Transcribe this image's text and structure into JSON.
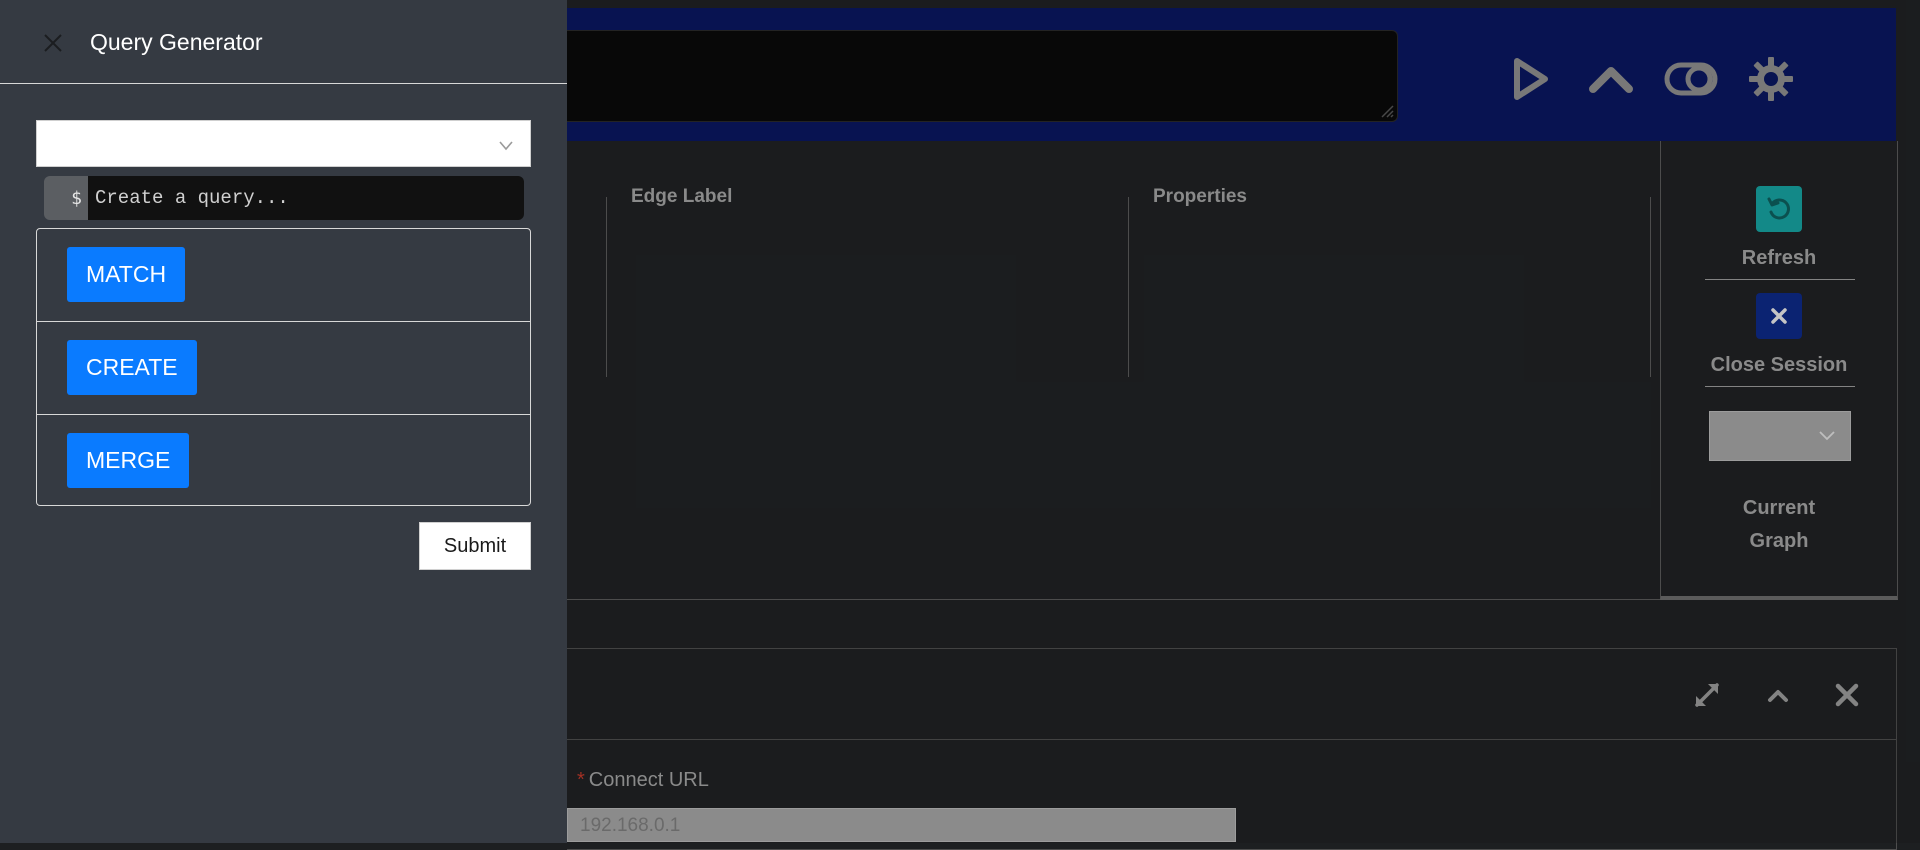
{
  "drawer": {
    "title": "Query Generator",
    "query_prefix": "$",
    "query_placeholder": "Create a query...",
    "clauses": [
      "MATCH",
      "CREATE",
      "MERGE"
    ],
    "submit_label": "Submit"
  },
  "meta": {
    "edge_label_header": "Edge Label",
    "properties_header": "Properties"
  },
  "side": {
    "refresh_label": "Refresh",
    "close_session_label": "Close Session",
    "current_graph_label_line1": "Current",
    "current_graph_label_line2": "Graph"
  },
  "connection": {
    "url_label": "Connect URL",
    "url_value": "192.168.0.1"
  },
  "colors": {
    "accent_blue": "#0a7bff",
    "topbar_navy": "#0a1760",
    "refresh_teal": "#17a2a0",
    "close_navy": "#0e2a86"
  }
}
